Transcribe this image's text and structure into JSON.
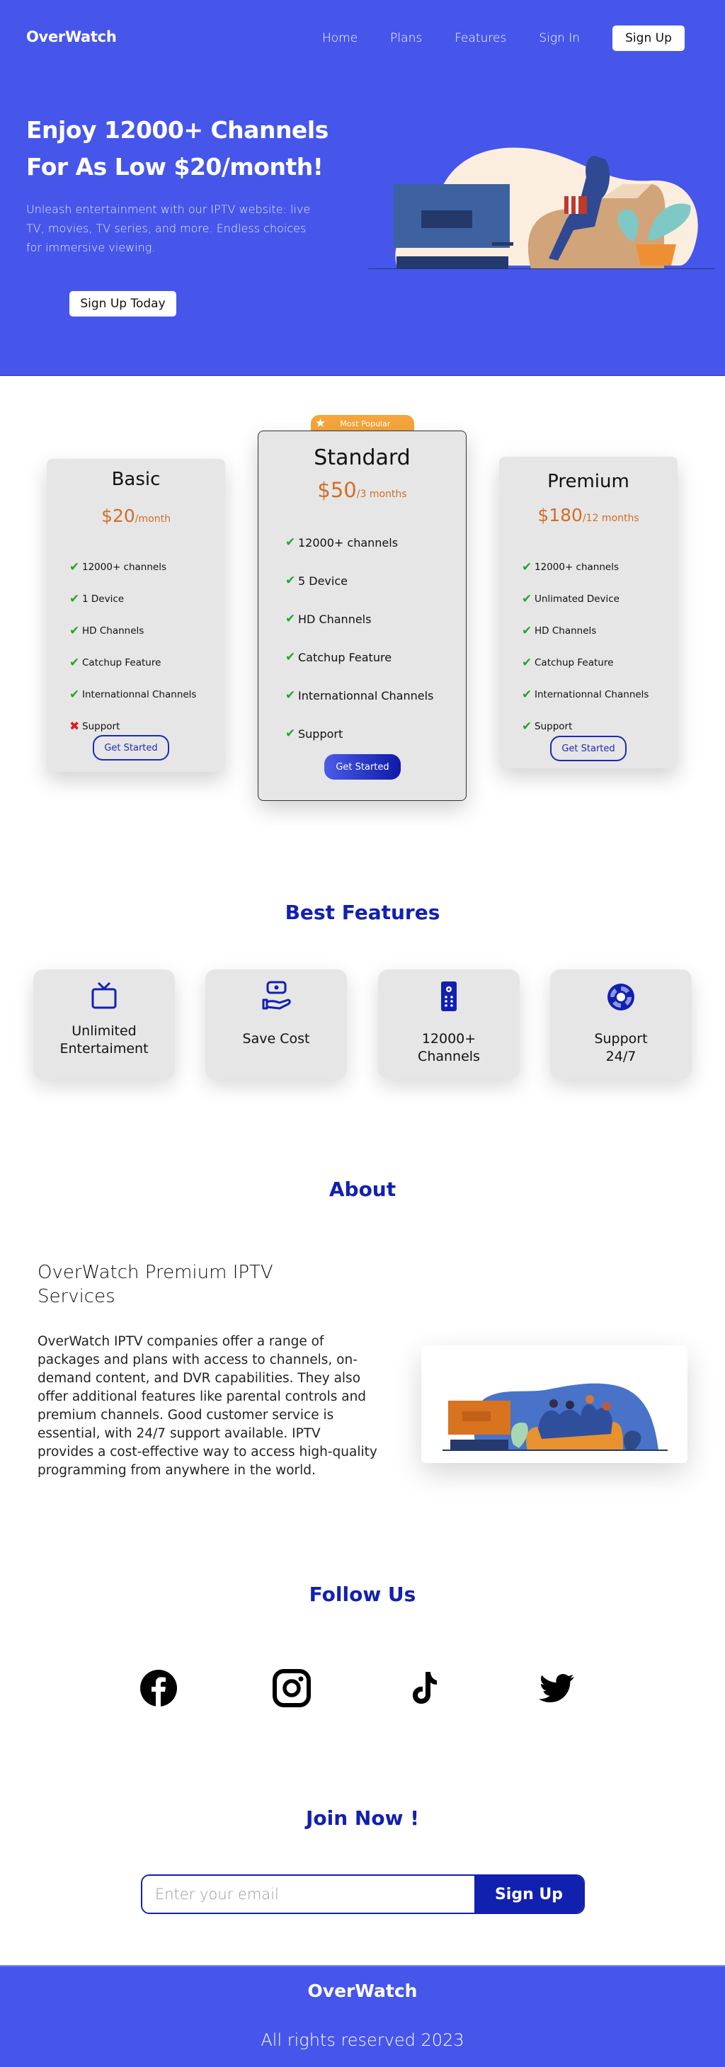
{
  "header": {
    "logo": "OverWatch",
    "nav": [
      "Home",
      "Plans",
      "Features",
      "Sign In"
    ],
    "signup_label": "Sign Up"
  },
  "hero": {
    "title": "Enjoy 12000+ Channels For As Low $20/month!",
    "description": "Unleash entertainment with our IPTV website: live TV, movies, TV series, and more. Endless choices for immersive viewing.",
    "cta_label": "Sign Up Today",
    "illustration": "woman-watching-tv-illustration"
  },
  "pricing": {
    "badge": "Most Popular",
    "plans": [
      {
        "name": "Basic",
        "price": "$20",
        "period": "/month",
        "features": [
          {
            "label": "12000+ channels",
            "included": true
          },
          {
            "label": "1 Device",
            "included": true
          },
          {
            "label": "HD Channels",
            "included": true
          },
          {
            "label": "Catchup Feature",
            "included": true
          },
          {
            "label": "Internationnal Channels",
            "included": true
          },
          {
            "label": "Support",
            "included": false
          }
        ],
        "button": "Get Started"
      },
      {
        "name": "Standard",
        "price": "$50",
        "period": "/3 months",
        "features": [
          {
            "label": "12000+ channels",
            "included": true
          },
          {
            "label": "5 Device",
            "included": true
          },
          {
            "label": "HD Channels",
            "included": true
          },
          {
            "label": "Catchup Feature",
            "included": true
          },
          {
            "label": "Internationnal Channels",
            "included": true
          },
          {
            "label": "Support",
            "included": true
          }
        ],
        "button": "Get Started"
      },
      {
        "name": "Premium",
        "price": "$180",
        "period": "/12 months",
        "features": [
          {
            "label": "12000+ channels",
            "included": true
          },
          {
            "label": "Unlimated Device",
            "included": true
          },
          {
            "label": "HD Channels",
            "included": true
          },
          {
            "label": "Catchup Feature",
            "included": true
          },
          {
            "label": "Internationnal Channels",
            "included": true
          },
          {
            "label": "Support",
            "included": true
          }
        ],
        "button": "Get Started"
      }
    ],
    "check_glyph": "✔",
    "cross_glyph": "✖"
  },
  "features": {
    "title": "Best Features",
    "items": [
      {
        "label": "Unlimited\nEntertaiment",
        "icon": "tv-icon"
      },
      {
        "label": "Save Cost",
        "icon": "money-hand-icon"
      },
      {
        "label": "12000+\nChannels",
        "icon": "remote-control-icon"
      },
      {
        "label": "Support\n24/7",
        "icon": "lifebuoy-icon"
      }
    ]
  },
  "about": {
    "title": "About",
    "heading": "OverWatch Premium IPTV Services",
    "text": "OverWatch IPTV companies offer a range of packages and plans with access to channels, on-demand content, and DVR capabilities. They also offer additional features like parental controls and premium channels. Good customer service is essential, with 24/7 support available. IPTV provides a cost-effective way to access high-quality programming from anywhere in the world.",
    "illustration": "friends-watching-tv-illustration"
  },
  "social": {
    "title": "Follow Us",
    "items": [
      "facebook",
      "instagram",
      "tiktok",
      "twitter"
    ]
  },
  "join": {
    "title": "Join Now !",
    "placeholder": "Enter your email",
    "value": "",
    "button": "Sign Up"
  },
  "footer": {
    "brand": "OverWatch",
    "copyright": "All rights reserved 2023"
  },
  "colors": {
    "brand_blue": "#4656eb",
    "heading_blue": "#1220b0",
    "price_orange": "#d06f25",
    "badge_orange": "#f5a53b",
    "check_green": "#21a52a",
    "cross_red": "#e01b1b",
    "card_gray": "#e7e6e7"
  }
}
